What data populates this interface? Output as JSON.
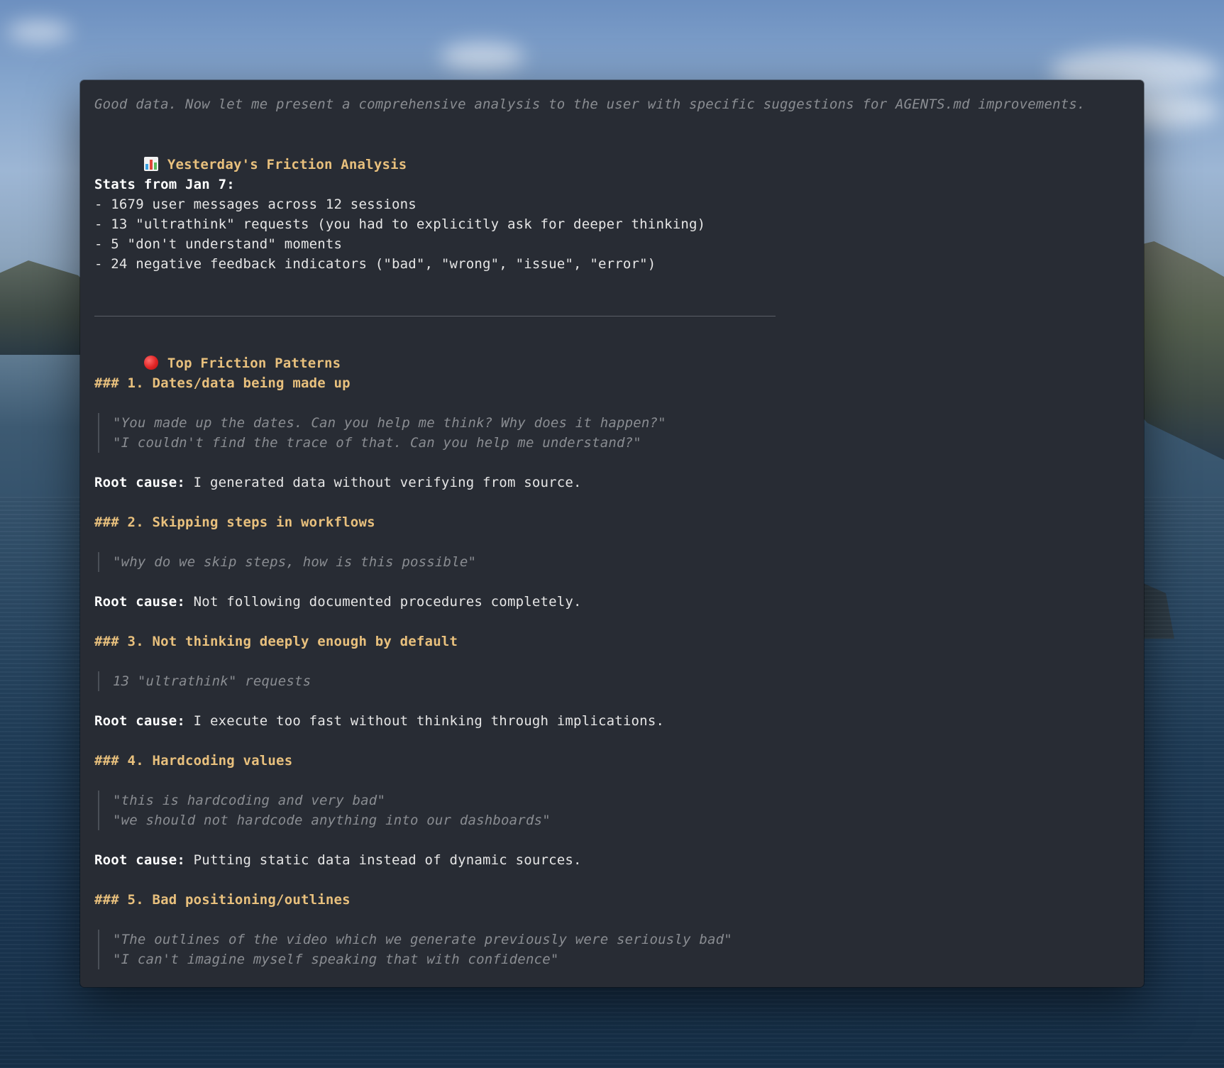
{
  "thinking_text": "Good data. Now let me present a comprehensive analysis to the user with specific suggestions for AGENTS.md improvements.",
  "section1": {
    "icon": "bar-chart-icon",
    "title": "Yesterday's Friction Analysis"
  },
  "stats": {
    "title": "Stats from Jan 7:",
    "items": [
      "- 1679 user messages across 12 sessions",
      "- 13 \"ultrathink\" requests (you had to explicitly ask for deeper thinking)",
      "- 5 \"don't understand\" moments",
      "- 24 negative feedback indicators (\"bad\", \"wrong\", \"issue\", \"error\")"
    ]
  },
  "section2": {
    "icon": "red-circle-icon",
    "title": "Top Friction Patterns"
  },
  "root_label": "Root cause:",
  "patterns": [
    {
      "heading": "### 1. Dates/data being made up",
      "quotes": [
        "\"You made up the dates. Can you help me think? Why does it happen?\"",
        "\"I couldn't find the trace of that. Can you help me understand?\""
      ],
      "root_cause": " I generated data without verifying from source."
    },
    {
      "heading": "### 2. Skipping steps in workflows",
      "quotes": [
        "\"why do we skip steps, how is this possible\""
      ],
      "root_cause": " Not following documented procedures completely."
    },
    {
      "heading": "### 3. Not thinking deeply enough by default",
      "quotes": [
        "13 \"ultrathink\" requests"
      ],
      "root_cause": " I execute too fast without thinking through implications."
    },
    {
      "heading": "### 4. Hardcoding values",
      "quotes": [
        "\"this is hardcoding and very bad\"",
        "\"we should not hardcode anything into our dashboards\""
      ],
      "root_cause": " Putting static data instead of dynamic sources."
    },
    {
      "heading": "### 5. Bad positioning/outlines",
      "quotes": [
        "\"The outlines of the video which we generate previously were seriously bad\"",
        "\"I can't imagine myself speaking that with confidence\""
      ]
    }
  ]
}
